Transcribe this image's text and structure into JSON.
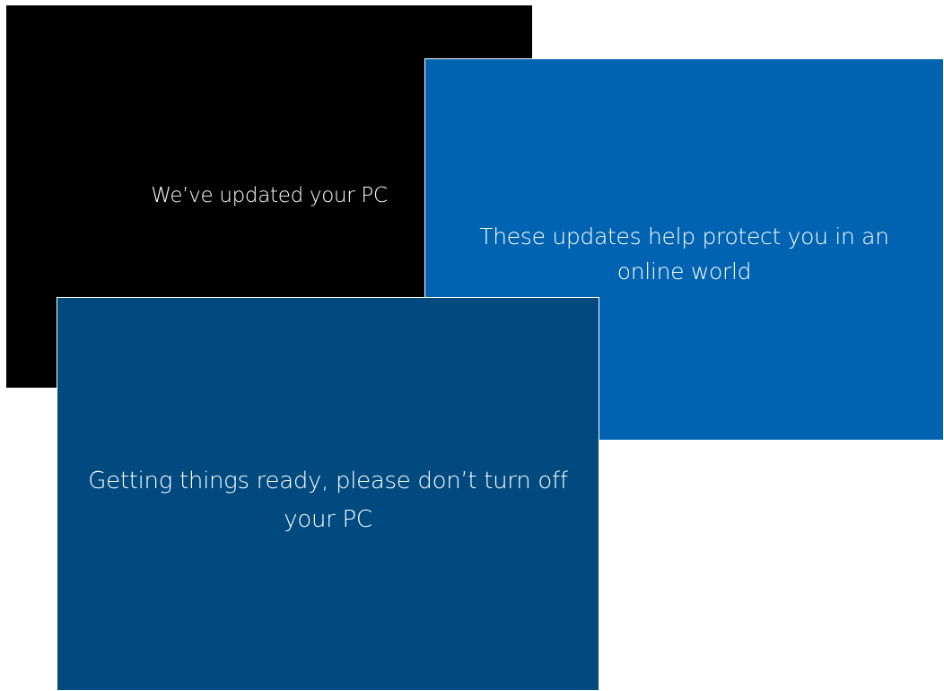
{
  "screens": {
    "black": {
      "message": "We’ve updated your PC",
      "background": "#000000"
    },
    "blue": {
      "message_line1": "These updates help protect you in an",
      "message_line2": "online world",
      "background": "#0063b1"
    },
    "darkblue": {
      "message_line1": "Getting things ready, please don’t turn off",
      "message_line2": "your PC",
      "background": "#004a80"
    }
  }
}
